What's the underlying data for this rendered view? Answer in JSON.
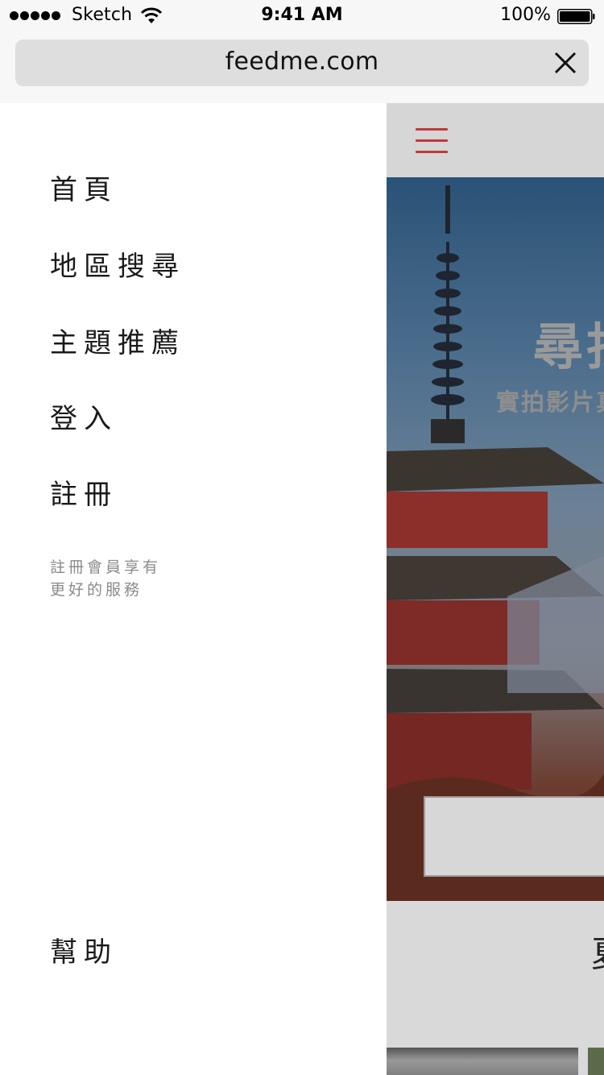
{
  "status_bar": {
    "carrier": "Sketch",
    "time": "9:41 AM",
    "battery_percent": "100%",
    "icons": [
      "signal-dots-icon",
      "wifi-icon",
      "battery-icon"
    ]
  },
  "browser": {
    "url": "feedme.com",
    "close_icon": "close-icon"
  },
  "menu": {
    "items": [
      {
        "label": "首頁"
      },
      {
        "label": "地區搜尋"
      },
      {
        "label": "主題推薦"
      },
      {
        "label": "登入"
      },
      {
        "label": "註冊"
      }
    ],
    "note_line1": "註冊會員享有",
    "note_line2": "更好的服務",
    "help": "幫助"
  },
  "page": {
    "menu_icon": "hamburger-icon",
    "hero_title": "尋找",
    "hero_subtitle": "實拍影片真",
    "section_title": "夏"
  },
  "colors": {
    "accent": "#c0393b",
    "menu_text": "#1a1a1a",
    "note_text": "#8a8a8a",
    "chrome_bg": "#f7f7f7",
    "url_field_bg": "#dedede"
  }
}
